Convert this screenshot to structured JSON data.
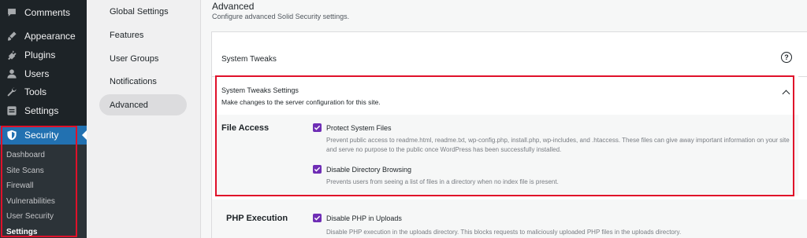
{
  "wp_menu": {
    "items": [
      {
        "label": "Comments",
        "icon": "comment-icon"
      },
      {
        "label": "Appearance",
        "icon": "paintbrush-icon"
      },
      {
        "label": "Plugins",
        "icon": "plug-icon"
      },
      {
        "label": "Users",
        "icon": "user-icon"
      },
      {
        "label": "Tools",
        "icon": "wrench-icon"
      },
      {
        "label": "Settings",
        "icon": "settings-icon"
      }
    ],
    "security": {
      "label": "Security",
      "icon": "shield-icon"
    },
    "sub_items": [
      "Dashboard",
      "Site Scans",
      "Firewall",
      "Vulnerabilities",
      "User Security",
      "Settings"
    ]
  },
  "settings_nav": {
    "items": [
      "Global Settings",
      "Features",
      "User Groups",
      "Notifications",
      "Advanced"
    ],
    "active": "Advanced"
  },
  "page": {
    "title": "Advanced",
    "description": "Configure advanced Solid Security settings."
  },
  "card": {
    "title": "System Tweaks",
    "help_icon": "help-circle-icon",
    "section": {
      "title": "System Tweaks Settings",
      "subtitle": "Make changes to the server configuration for this site.",
      "caret_icon": "chevron-up-icon"
    },
    "file_access": {
      "label": "File Access",
      "options": [
        {
          "label": "Protect System Files",
          "checked": true,
          "help": "Prevent public access to readme.html, readme.txt, wp-config.php, install.php, wp-includes, and .htaccess. These files can give away important information on your site and serve no purpose to the public once WordPress has been successfully installed."
        },
        {
          "label": "Disable Directory Browsing",
          "checked": true,
          "help": "Prevents users from seeing a list of files in a directory when no index file is present."
        }
      ]
    },
    "php_execution": {
      "label": "PHP Execution",
      "options": [
        {
          "label": "Disable PHP in Uploads",
          "checked": true,
          "help": "Disable PHP execution in the uploads directory. This blocks requests to maliciously uploaded PHP files in the uploads directory."
        }
      ]
    }
  },
  "colors": {
    "wp_sidebar": "#1d2327",
    "wp_active": "#2271b1",
    "checkbox": "#6f2eb5",
    "highlight": "#e0112a"
  }
}
